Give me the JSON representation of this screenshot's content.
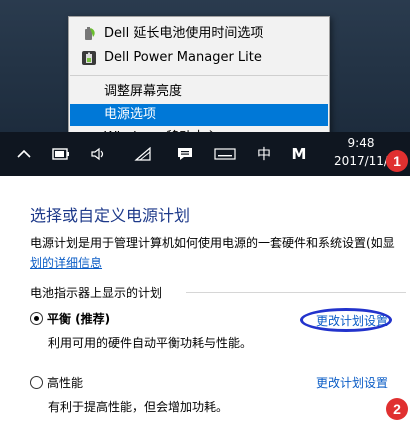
{
  "context_menu": {
    "items": [
      {
        "label": "Dell 延长电池使用时间选项",
        "icon": "battery-leaf-icon"
      },
      {
        "label": "Dell Power Manager Lite",
        "icon": "power-manager-icon"
      },
      {
        "label": "调整屏幕亮度"
      },
      {
        "label": "电源选项",
        "highlighted": true
      },
      {
        "label": "Windows 移动中心"
      }
    ]
  },
  "taskbar": {
    "icons": [
      "chevron-up-icon",
      "battery-icon",
      "volume-icon",
      "network-icon",
      "action-center-icon",
      "keyboard-icon",
      "ime-icon",
      "ime-mode-icon"
    ],
    "ime_label": "中",
    "ime_mode_label": "M",
    "clock": {
      "time": "9:48",
      "date": "2017/11/"
    }
  },
  "badges": {
    "first": "1",
    "second": "2"
  },
  "power_options": {
    "title": "选择或自定义电源计划",
    "description": "电源计划是用于管理计算机如何使用电源的一套硬件和系统设置(如显",
    "link_more": "划的详细信息",
    "section_label": "电池指示器上显示的计划",
    "plans": [
      {
        "name": "平衡 (推荐)",
        "selected": true,
        "description": "利用可用的硬件自动平衡功耗与性能。",
        "change_link": "更改计划设置"
      },
      {
        "name": "高性能",
        "selected": false,
        "description": "有利于提高性能，但会增加功耗。",
        "change_link": "更改计划设置"
      }
    ]
  },
  "colors": {
    "highlight": "#0078d7",
    "link": "#0a5cc6",
    "title": "#1e3a8a",
    "badge": "#e03030",
    "annotation_circle": "#2233cc",
    "taskbar": "#0f1620"
  }
}
